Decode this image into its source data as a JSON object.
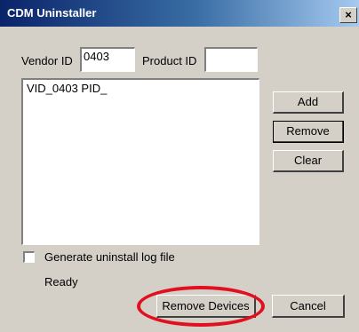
{
  "window": {
    "title": "CDM Uninstaller",
    "close_glyph": "×"
  },
  "form": {
    "vendor_label": "Vendor ID",
    "vendor_value": "0403",
    "product_label": "Product ID",
    "product_value": ""
  },
  "device_list": {
    "items": [
      "VID_0403 PID_"
    ]
  },
  "side_buttons": {
    "add": "Add",
    "remove": "Remove",
    "clear": "Clear"
  },
  "options": {
    "log_label": "Generate uninstall log file",
    "log_checked": false
  },
  "status": {
    "text": "Ready"
  },
  "footer": {
    "remove_devices": "Remove Devices",
    "cancel": "Cancel"
  },
  "annotation": {
    "highlight_color": "#e01020"
  }
}
